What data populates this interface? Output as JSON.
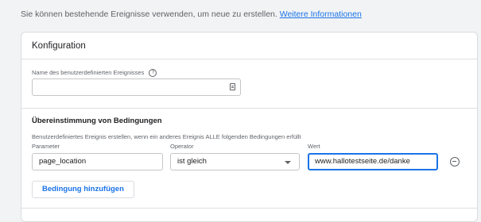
{
  "intro": {
    "text": "Sie können bestehende Ereignisse verwenden, um neue zu erstellen.",
    "link": "Weitere Informationen"
  },
  "config": {
    "title": "Konfiguration",
    "event_name_label": "Name des benutzerdefinierten Ereignisses",
    "event_name_value": ""
  },
  "conditions": {
    "title": "Übereinstimmung von Bedingungen",
    "description": "Benutzerdefiniertes Ereignis erstellen, wenn ein anderes Ereignis ALLE folgenden Bedingungen erfüllt",
    "parameter_label": "Parameter",
    "parameter_value": "page_location",
    "operator_label": "Operator",
    "operator_value": "ist gleich",
    "value_label": "Wert",
    "value_value": "www.hallotestseite.de/danke",
    "add_button": "Bedingung hinzufügen"
  }
}
